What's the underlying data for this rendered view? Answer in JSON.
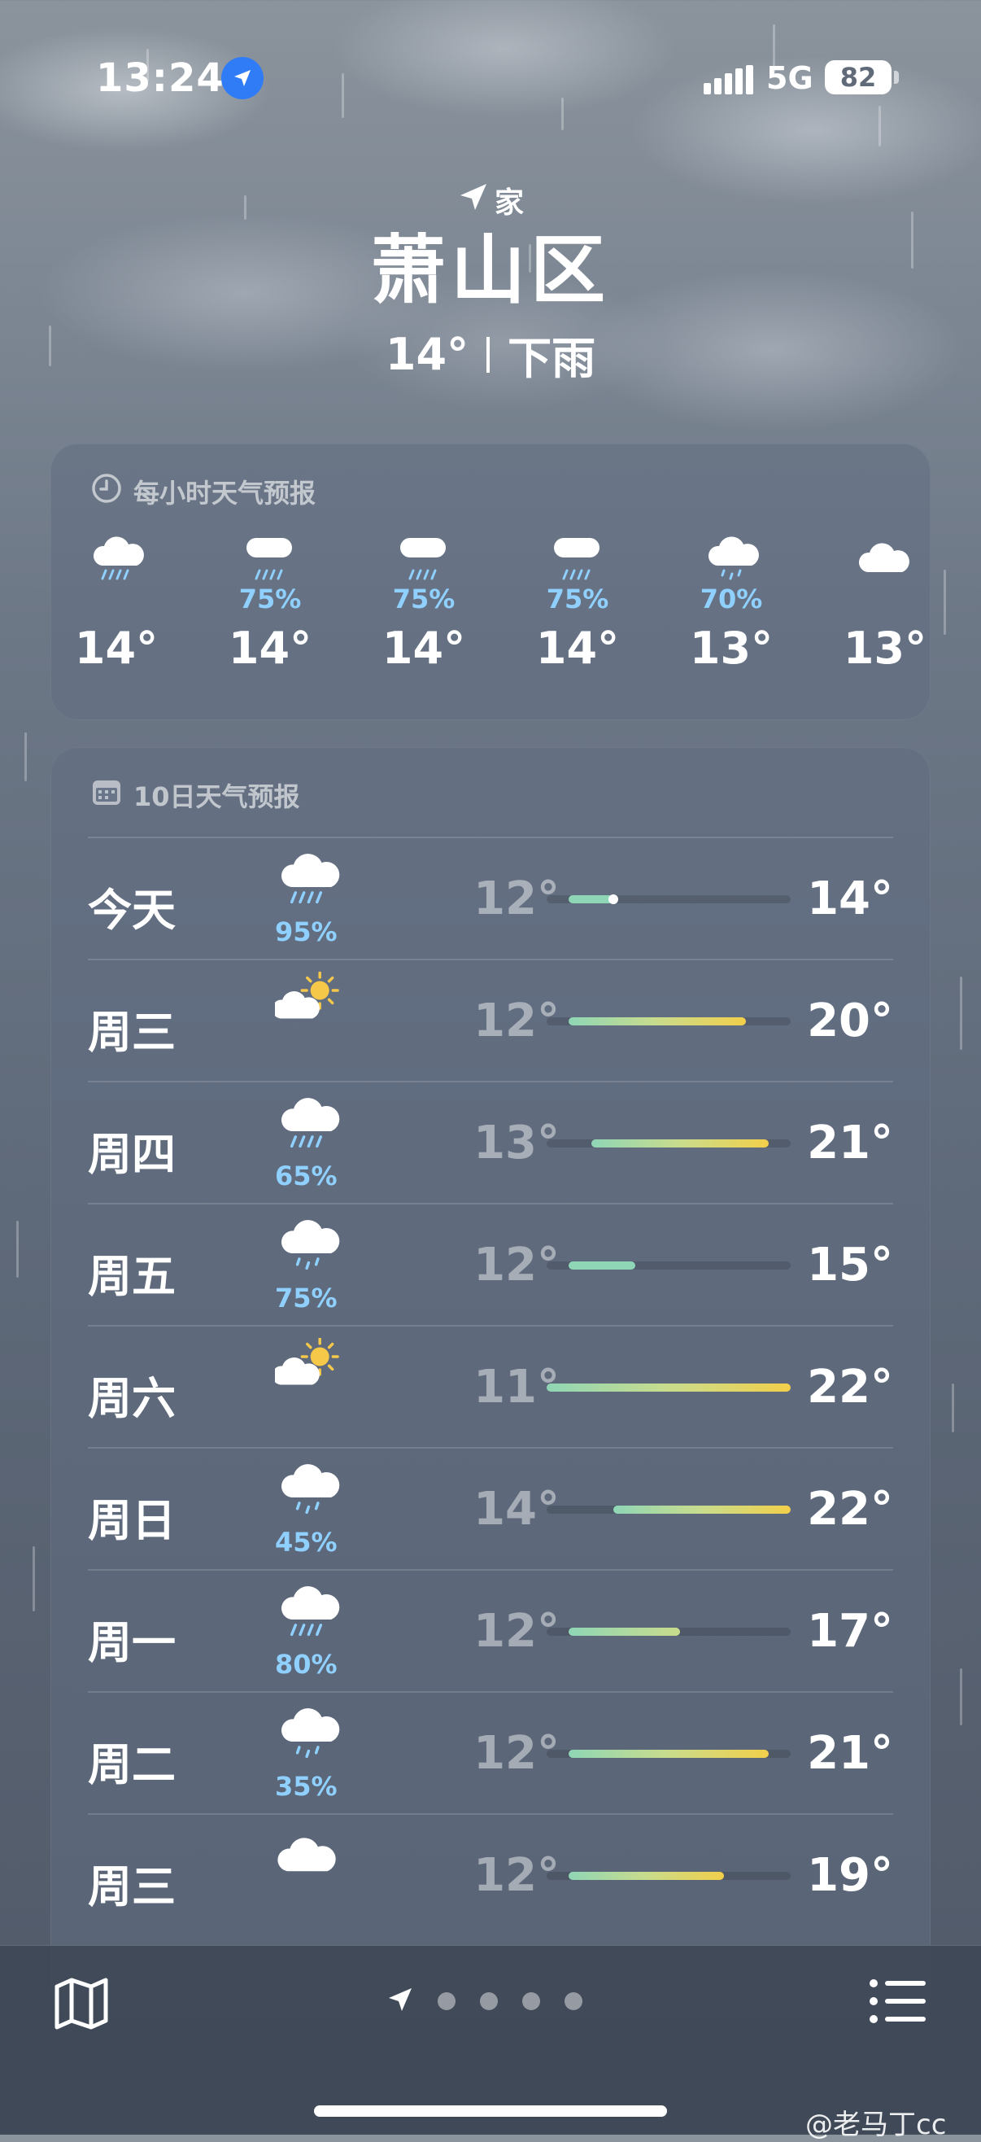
{
  "status_bar": {
    "time": "13:24",
    "network": "5G",
    "battery": "82"
  },
  "header": {
    "home_label": "家",
    "city": "萧山区",
    "temperature": "14°",
    "condition": "下雨"
  },
  "hourly": {
    "title": "每小时天气预报",
    "items": [
      {
        "icon": "rain-icon",
        "chance": "",
        "temp": "14°"
      },
      {
        "icon": "heavy-rain-icon",
        "chance": "75%",
        "temp": "14°"
      },
      {
        "icon": "heavy-rain-icon",
        "chance": "75%",
        "temp": "14°"
      },
      {
        "icon": "heavy-rain-icon",
        "chance": "75%",
        "temp": "14°"
      },
      {
        "icon": "drizzle-icon",
        "chance": "70%",
        "temp": "13°"
      },
      {
        "icon": "cloud-icon",
        "chance": "",
        "temp": "13°"
      }
    ]
  },
  "daily": {
    "title": "10日天气预报",
    "range": [
      11,
      22
    ],
    "current": 14,
    "colors": {
      "cool": "#8fd6b6",
      "mid": "#c9dc8c",
      "warm": "#f2cf4a"
    },
    "items": [
      {
        "day": "今天",
        "icon": "rain-icon",
        "chance": "95%",
        "low": "12°",
        "high": "14°",
        "low_val": 12,
        "high_val": 14
      },
      {
        "day": "周三",
        "icon": "partly-sunny-icon",
        "chance": "",
        "low": "12°",
        "high": "20°",
        "low_val": 12,
        "high_val": 20
      },
      {
        "day": "周四",
        "icon": "rain-icon",
        "chance": "65%",
        "low": "13°",
        "high": "21°",
        "low_val": 13,
        "high_val": 21
      },
      {
        "day": "周五",
        "icon": "drizzle-icon",
        "chance": "75%",
        "low": "12°",
        "high": "15°",
        "low_val": 12,
        "high_val": 15
      },
      {
        "day": "周六",
        "icon": "partly-sunny-icon",
        "chance": "",
        "low": "11°",
        "high": "22°",
        "low_val": 11,
        "high_val": 22
      },
      {
        "day": "周日",
        "icon": "drizzle-icon",
        "chance": "45%",
        "low": "14°",
        "high": "22°",
        "low_val": 14,
        "high_val": 22
      },
      {
        "day": "周一",
        "icon": "rain-icon",
        "chance": "80%",
        "low": "12°",
        "high": "17°",
        "low_val": 12,
        "high_val": 17
      },
      {
        "day": "周二",
        "icon": "drizzle-icon",
        "chance": "35%",
        "low": "12°",
        "high": "21°",
        "low_val": 12,
        "high_val": 21
      },
      {
        "day": "周三",
        "icon": "cloud-icon",
        "chance": "",
        "low": "12°",
        "high": "19°",
        "low_val": 12,
        "high_val": 19
      }
    ]
  },
  "watermark": "@老马丁cc"
}
